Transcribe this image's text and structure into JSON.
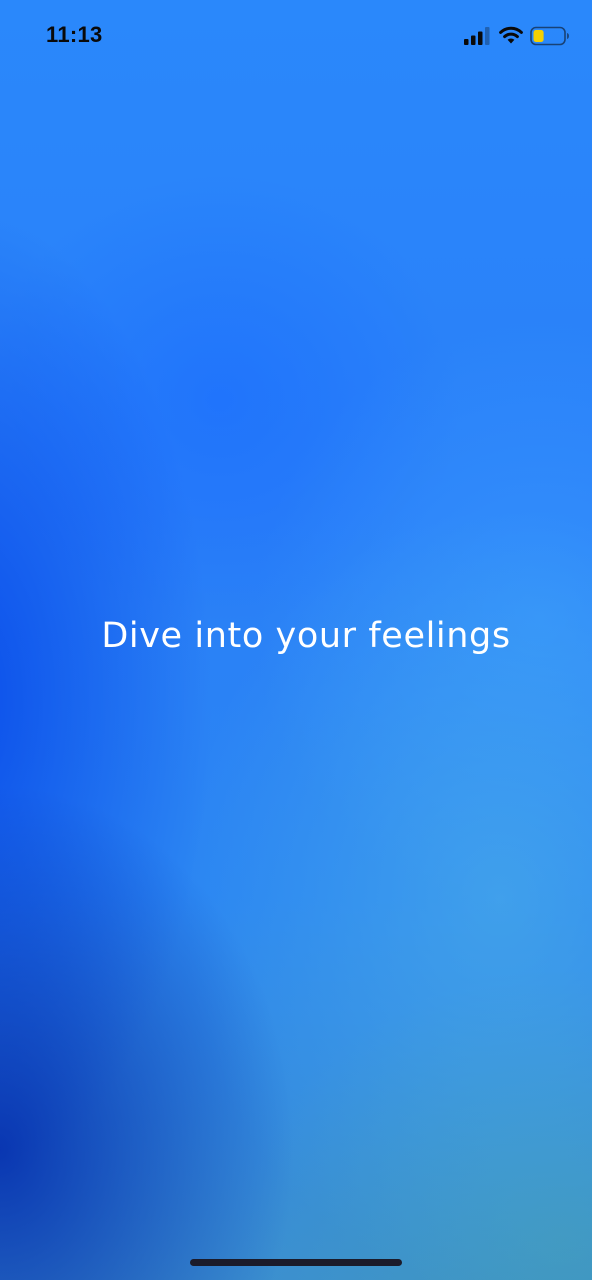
{
  "status_bar": {
    "time": "11:13",
    "icons": [
      "signal-icon",
      "wifi-icon",
      "battery-icon"
    ],
    "battery_level": 0.35,
    "battery_color": "#f5d000"
  },
  "main": {
    "headline": "Dive into your feelings"
  },
  "colors": {
    "background_primary": "#2a86ff",
    "background_deep": "#0228aa",
    "text": "#ffffff",
    "home_indicator": "#1b1b2a"
  }
}
